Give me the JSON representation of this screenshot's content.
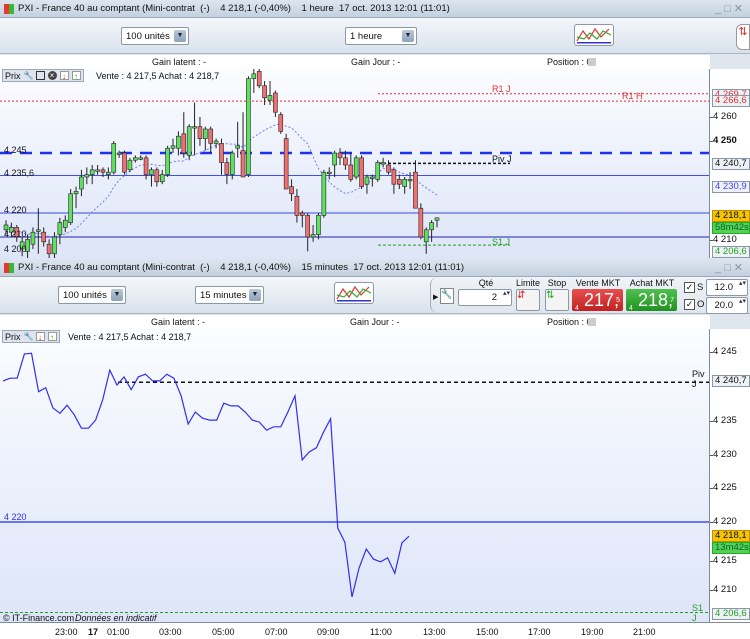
{
  "window1": {
    "title": "PXI - France 40 au comptant (Mini-contrat  (-)    4 218,1 (-0,40%)    1 heure  17 oct. 2013 12:01 (11:01)",
    "units_select": "100 unités",
    "period_select": "1 heure",
    "info": {
      "gain_latent": "Gain latent : -",
      "gain_jour": "Gain Jour : -",
      "position": "Position : 0"
    },
    "prix_label": "Prix",
    "quote": "Vente : 4 217,5 Achat : 4 218,7",
    "left_levels": [
      "4 245",
      "4 235,6",
      "4 220",
      "4 210",
      "4 200"
    ],
    "line_labels": {
      "r1j": "R1 J",
      "r1h": "R1 H",
      "pivj": "Piv J",
      "s1j": "S1 J"
    },
    "axis_ticks": [
      "4 260",
      "4 250"
    ],
    "axis_boxes": {
      "r1j": "4 269,7",
      "r1h": "4 266,6",
      "pivj": "4 240,7",
      "ma": "4 230,9",
      "last": "4 218,1",
      "timer": "58m42s",
      "s1j": "4 206,6",
      "hidden": "4 210"
    }
  },
  "window2": {
    "title": "PXI - France 40 au comptant (Mini-contrat  (-)    4 218,1 (-0,40%)    15 minutes  17 oct. 2013 12:01 (11:01)",
    "units_select": "100 unités",
    "period_select": "15 minutes",
    "order": {
      "qty_label": "Qté",
      "qty": "2",
      "limit_label": "Limite",
      "stop_label": "Stop",
      "sell_label": "Vente MKT",
      "sell_prefix": "4",
      "sell_big": "217,",
      "sell_sup": "5",
      "buy_label": "Achat MKT",
      "buy_prefix": "4",
      "buy_big": "218,",
      "buy_sup": "7",
      "s_label": "S",
      "o_label": "O",
      "s_value": "12.0",
      "o_value": "20.0"
    },
    "info": {
      "gain_latent": "Gain latent : -",
      "gain_jour": "Gain Jour : -",
      "position": "Position : 0"
    },
    "prix_label": "Prix",
    "quote": "Vente : 4 217,5 Achat : 4 218,7",
    "left_levels": [
      "4 220"
    ],
    "line_labels": {
      "pivj": "Piv J",
      "s1j": "S1 J"
    },
    "axis_ticks": [
      "4 245",
      "4 235",
      "4 230",
      "4 225",
      "4 220",
      "4 215",
      "4 210"
    ],
    "axis_boxes": {
      "pivj": "4 240,7",
      "last": "4 218,1",
      "timer": "13m42s",
      "s1j": "4 206,6"
    },
    "copyright": "© IT-Finance.com",
    "disclaimer": "Données en indicatif",
    "time_labels": [
      "23:00",
      "17",
      "01:00",
      "03:00",
      "05:00",
      "07:00",
      "09:00",
      "11:00",
      "13:00",
      "15:00",
      "17:00",
      "19:00",
      "21:00"
    ]
  },
  "colors": {
    "up": "#5fe05f",
    "down": "#f07070",
    "line": "#3030f0",
    "resistance": "#e03030",
    "support": "#20a020"
  },
  "chart_data": [
    {
      "type": "candlestick",
      "title": "PXI 1 heure",
      "ylim": [
        4200,
        4285
      ],
      "levels": {
        "R1 J": 4269.7,
        "R1 H": 4266.6,
        "Piv J": 4240.7,
        "S1 J": 4206.6,
        "4 245": 4245,
        "4 235,6": 4235.6,
        "4 220": 4220,
        "4 210": 4210
      },
      "ohlc": [
        [
          4213,
          4217,
          4211,
          4215
        ],
        [
          4212,
          4216,
          4210,
          4214
        ],
        [
          4214,
          4215,
          4208,
          4210
        ],
        [
          4205,
          4210,
          4202,
          4208
        ],
        [
          4204,
          4211,
          4201,
          4209
        ],
        [
          4207,
          4214,
          4205,
          4212
        ],
        [
          4213,
          4222,
          4203,
          4213
        ],
        [
          4212,
          4214,
          4206,
          4208
        ],
        [
          4207,
          4209,
          4200,
          4203
        ],
        [
          4203,
          4212,
          4201,
          4210
        ],
        [
          4211,
          4218,
          4207,
          4216
        ],
        [
          4214,
          4219,
          4212,
          4217
        ],
        [
          4216,
          4230,
          4215,
          4228
        ],
        [
          4228,
          4231,
          4222,
          4229
        ],
        [
          4230,
          4238,
          4227,
          4235
        ],
        [
          4235,
          4239,
          4232,
          4236
        ],
        [
          4236,
          4240,
          4232,
          4238
        ],
        [
          4238,
          4240,
          4236,
          4238
        ],
        [
          4238,
          4239,
          4235,
          4237
        ],
        [
          4236,
          4239,
          4234,
          4237
        ],
        [
          4237,
          4250,
          4236,
          4249
        ],
        [
          4245,
          4246,
          4243,
          4245
        ],
        [
          4245,
          4246,
          4236,
          4237
        ],
        [
          4238,
          4243,
          4237,
          4242
        ],
        [
          4242,
          4244,
          4241,
          4243
        ],
        [
          4243,
          4244,
          4242,
          4243
        ],
        [
          4243,
          4244,
          4234,
          4236
        ],
        [
          4236,
          4239,
          4231,
          4238
        ],
        [
          4238,
          4239,
          4231,
          4233
        ],
        [
          4233,
          4238,
          4232,
          4236
        ],
        [
          4236,
          4248,
          4235,
          4247
        ],
        [
          4247,
          4251,
          4245,
          4248
        ],
        [
          4247,
          4254,
          4244,
          4252
        ],
        [
          4253,
          4262,
          4243,
          4245
        ],
        [
          4244,
          4257,
          4242,
          4256
        ],
        [
          4256,
          4266,
          4244,
          4256
        ],
        [
          4256,
          4260,
          4248,
          4251
        ],
        [
          4251,
          4256,
          4246,
          4255
        ],
        [
          4255,
          4256,
          4245,
          4249
        ],
        [
          4249,
          4251,
          4247,
          4250
        ],
        [
          4249,
          4251,
          4236,
          4241
        ],
        [
          4241,
          4243,
          4232,
          4236
        ],
        [
          4236,
          4246,
          4234,
          4245
        ],
        [
          4247,
          4258,
          4243,
          4248
        ],
        [
          4246,
          4262,
          4235,
          4235
        ],
        [
          4236,
          4277,
          4235,
          4276
        ],
        [
          4276,
          4282,
          4270,
          4278
        ],
        [
          4279,
          4280,
          4272,
          4273
        ],
        [
          4273,
          4275,
          4265,
          4268
        ],
        [
          4267,
          4275,
          4265,
          4269
        ],
        [
          4270,
          4271,
          4260,
          4262
        ],
        [
          4261,
          4262,
          4253,
          4254
        ],
        [
          4251,
          4253,
          4230,
          4230
        ],
        [
          4231,
          4234,
          4225,
          4228
        ],
        [
          4227,
          4230,
          4216,
          4219
        ],
        [
          4220,
          4221,
          4214,
          4219
        ],
        [
          4219,
          4220,
          4204,
          4210
        ],
        [
          4210,
          4215,
          4208,
          4211
        ],
        [
          4211,
          4220,
          4209,
          4219
        ],
        [
          4219,
          4238,
          4218,
          4237
        ],
        [
          4237,
          4239,
          4234,
          4237
        ],
        [
          4240,
          4246,
          4235,
          4245
        ],
        [
          4245,
          4247,
          4240,
          4243
        ],
        [
          4243,
          4246,
          4238,
          4240
        ],
        [
          4240,
          4245,
          4233,
          4234
        ],
        [
          4235,
          4244,
          4234,
          4243
        ],
        [
          4243,
          4244,
          4230,
          4231
        ],
        [
          4232,
          4236,
          4228,
          4235
        ],
        [
          4235,
          4236,
          4231,
          4235
        ],
        [
          4234,
          4242,
          4233,
          4241
        ],
        [
          4241,
          4243,
          4239,
          4241
        ],
        [
          4240,
          4242,
          4236,
          4237
        ],
        [
          4238,
          4239,
          4228,
          4232
        ],
        [
          4234,
          4236,
          4230,
          4232
        ],
        [
          4231,
          4235,
          4228,
          4234
        ],
        [
          4234,
          4237,
          4230,
          4234
        ],
        [
          4237,
          4242,
          4225,
          4222
        ],
        [
          4222,
          4224,
          4209,
          4210
        ],
        [
          4208,
          4214,
          4203,
          4213
        ],
        [
          4213,
          4217,
          4208,
          4216
        ],
        [
          4217,
          4218,
          4214,
          4218
        ]
      ]
    },
    {
      "type": "line",
      "title": "PXI 15 minutes",
      "ylim": [
        4205.5,
        4249
      ],
      "levels": {
        "Piv J": 4240.7,
        "S1 J": 4206.6,
        "4 220": 4220
      },
      "values": [
        4240.9,
        4241.3,
        4241.3,
        4244.9,
        4245.0,
        4239.3,
        4239.9,
        4236.9,
        4236.1,
        4237.3,
        4235.9,
        4233.9,
        4233.9,
        4235.1,
        4238.1,
        4242.5,
        4240.3,
        4241.5,
        4239.6,
        4241.5,
        4241.9,
        4240.9,
        4240.9,
        4241.9,
        4241.3,
        4238.7,
        4234.5,
        4236.3,
        4235.4,
        4235.1,
        4235.1,
        4237.6,
        4237.2,
        4237.2,
        4236.3,
        4235.1,
        4234.8,
        4233.6,
        4234.1,
        4234.1,
        4236.3,
        4238.7,
        4229.2,
        4230.4,
        4231.0,
        4233.3,
        4235.3,
        4219.1,
        4217.0,
        4208.9,
        4213.2,
        4216.0,
        4214.5,
        4214.1,
        4214.7,
        4212.4,
        4216.9,
        4217.9
      ]
    }
  ]
}
